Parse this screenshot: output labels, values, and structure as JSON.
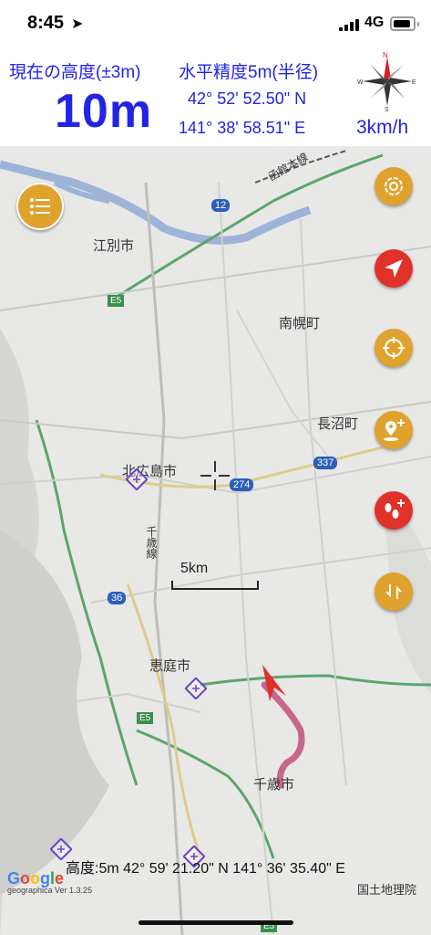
{
  "status_bar": {
    "time": "8:45",
    "network": "4G"
  },
  "info_panel": {
    "altitude_label": "現在の高度(±3m)",
    "altitude_value": "10m",
    "accuracy_label": "水平精度5m(半径)",
    "latitude": "42° 52' 52.50\" N",
    "longitude": "141° 38' 58.51\" E",
    "speed": "3km/h"
  },
  "map": {
    "place_labels": {
      "ebetsu": "江別市",
      "nanporo": "南幌町",
      "naganuma": "長沼町",
      "kitahiroshima": "北広島市",
      "eniwa": "恵庭市",
      "chitose": "千歳市",
      "hakodate_line": "函館本線",
      "chitose_line": "千歳線"
    },
    "road_shields": {
      "r12": "12",
      "r274": "274",
      "r337": "337",
      "r36": "36",
      "e5a": "E5",
      "e5b": "E5",
      "e5c": "E5"
    },
    "scale_label": "5km",
    "bottom_readout": "高度:5m  42° 59' 21.20\" N 141° 36' 35.40\" E",
    "google_logo": "Google",
    "app_version": "geographica Ver 1.3.25",
    "attribution": "国土地理院"
  },
  "buttons": {
    "menu": "menu-icon",
    "spiral": "spiral-icon",
    "navigation": "navigation-arrow-icon",
    "target": "crosshair-target-icon",
    "add_pin": "add-pin-icon",
    "add_footprints": "add-footprints-icon",
    "route": "route-icon"
  },
  "colors": {
    "accent_text": "#2223e6",
    "fab_yellow": "#dea22d",
    "fab_red": "#e0312b",
    "track": "#c0507a"
  }
}
